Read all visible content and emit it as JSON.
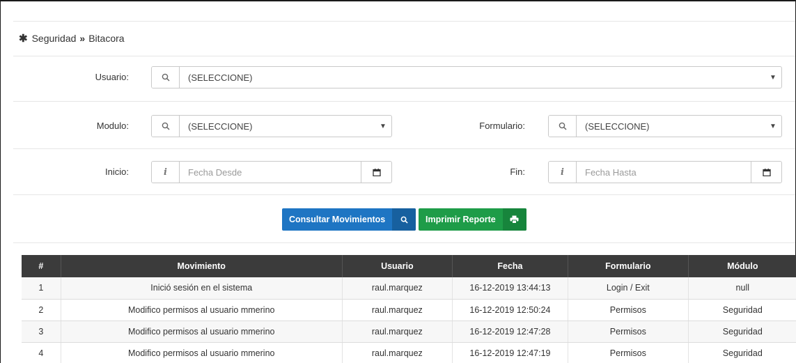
{
  "breadcrumb": {
    "section": "Seguridad",
    "separator": "»",
    "page": "Bitacora"
  },
  "filters": {
    "usuario": {
      "label": "Usuario:",
      "value": "(SELECCIONE)"
    },
    "modulo": {
      "label": "Modulo:",
      "value": "(SELECCIONE)"
    },
    "formulario": {
      "label": "Formulario:",
      "value": "(SELECCIONE)"
    },
    "inicio": {
      "label": "Inicio:",
      "placeholder": "Fecha Desde"
    },
    "fin": {
      "label": "Fin:",
      "placeholder": "Fecha Hasta"
    }
  },
  "actions": {
    "consultar": "Consultar Movimientos",
    "imprimir": "Imprimir Reporte"
  },
  "table": {
    "headers": [
      "#",
      "Movimiento",
      "Usuario",
      "Fecha",
      "Formulario",
      "Módulo"
    ],
    "rows": [
      [
        "1",
        "Inició sesión en el sistema",
        "raul.marquez",
        "16-12-2019 13:44:13",
        "Login / Exit",
        "null"
      ],
      [
        "2",
        "Modifico permisos al usuario mmerino",
        "raul.marquez",
        "16-12-2019 12:50:24",
        "Permisos",
        "Seguridad"
      ],
      [
        "3",
        "Modifico permisos al usuario mmerino",
        "raul.marquez",
        "16-12-2019 12:47:28",
        "Permisos",
        "Seguridad"
      ],
      [
        "4",
        "Modifico permisos al usuario mmerino",
        "raul.marquez",
        "16-12-2019 12:47:19",
        "Permisos",
        "Seguridad"
      ]
    ]
  },
  "colors": {
    "primary": "#1e75c3",
    "success": "#1e9c48",
    "table_header": "#3b3b3b"
  }
}
